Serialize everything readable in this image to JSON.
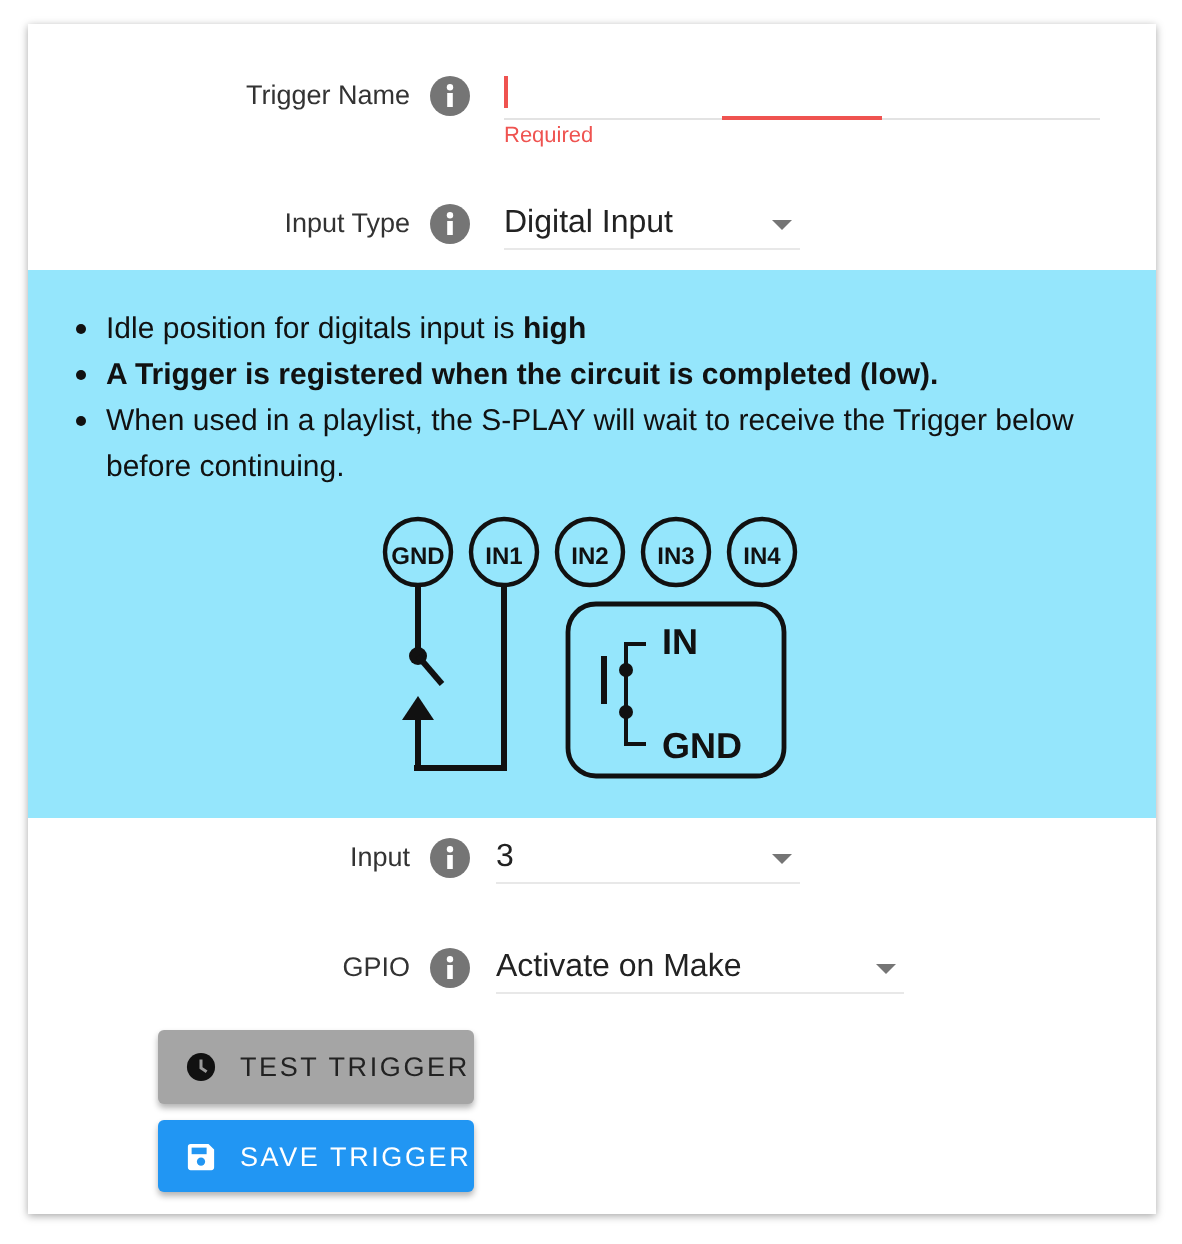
{
  "top_fields": [
    {
      "kind": "text",
      "label": "Trigger Name",
      "error": "Required"
    },
    {
      "kind": "select",
      "label": "Input Type",
      "value": "Digital Input"
    }
  ],
  "info": {
    "bullets": [
      {
        "text": "Idle position for digitals input is **high**",
        "bold": false
      },
      {
        "text": "A Trigger is registered when the circuit is completed (low).",
        "bold": true
      },
      {
        "text": "When used in a playlist, the S-PLAY will wait to receive the Trigger below before continuing.",
        "bold": false
      }
    ],
    "terminals": [
      "GND",
      "IN1",
      "IN2",
      "IN3",
      "IN4"
    ],
    "switch_labels": [
      "IN",
      "GND"
    ]
  },
  "bottom_fields": [
    {
      "kind": "select",
      "label": "Input",
      "value": "3"
    },
    {
      "kind": "select",
      "label": "GPIO",
      "value": "Activate on Make"
    }
  ],
  "buttons": [
    {
      "kind": "test",
      "label": "TEST TRIGGER"
    },
    {
      "kind": "save",
      "label": "SAVE TRIGGER"
    }
  ]
}
